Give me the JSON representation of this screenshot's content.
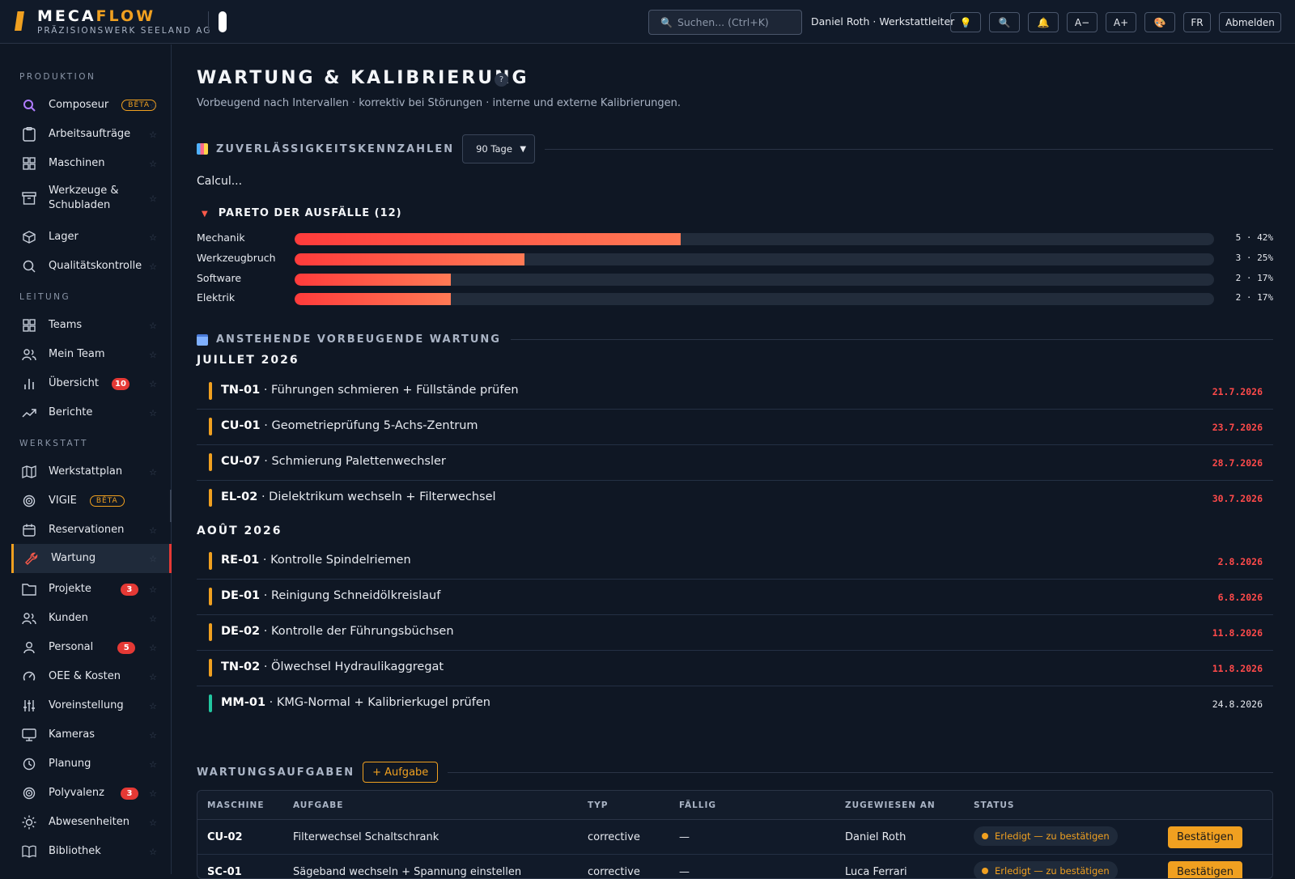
{
  "header": {
    "brand_a": "MECA",
    "brand_b": "FLOW",
    "brand_sub": "PRÄZISIONSWERK SEELAND AG",
    "search_placeholder": "Suchen...  (Ctrl+K)",
    "user": "Daniel Roth · Werkstattleiter",
    "btn_font_smaller": "A−",
    "btn_font_larger": "A+",
    "btn_lang": "FR",
    "btn_logout": "Abmelden"
  },
  "sidebar": {
    "sections": [
      "PRODUKTION",
      "LEITUNG",
      "WERKSTATT"
    ],
    "items": [
      {
        "label": "Composeur",
        "badge": "BÊTA"
      },
      {
        "label": "Arbeitsaufträge"
      },
      {
        "label": "Maschinen"
      },
      {
        "label": "Werkzeuge & Schubladen"
      },
      {
        "label": "Lager"
      },
      {
        "label": "Qualitätskontrolle"
      },
      {
        "label": "Teams"
      },
      {
        "label": "Mein Team"
      },
      {
        "label": "Übersicht",
        "count": "10"
      },
      {
        "label": "Berichte"
      },
      {
        "label": "Werkstattplan"
      },
      {
        "label": "VIGIE",
        "badge": "BÊTA"
      },
      {
        "label": "Reservationen"
      },
      {
        "label": "Wartung",
        "active": true
      },
      {
        "label": "Projekte",
        "count": "3"
      },
      {
        "label": "Kunden"
      },
      {
        "label": "Personal",
        "count": "5"
      },
      {
        "label": "OEE & Kosten"
      },
      {
        "label": "Voreinstellung"
      },
      {
        "label": "Kameras"
      },
      {
        "label": "Planung"
      },
      {
        "label": "Polyvalenz",
        "count": "3"
      },
      {
        "label": "Abwesenheiten"
      },
      {
        "label": "Bibliothek"
      }
    ]
  },
  "page": {
    "title": "WARTUNG & KALIBRIERUNG",
    "help": "?",
    "subtitle": "Vorbeugend nach Intervallen · korrektiv bei Störungen · interne und externe Kalibrierungen."
  },
  "reliability": {
    "heading": "ZUVERLÄSSIGKEITSKENNZAHLEN",
    "period": "90 Tage",
    "calc": "Calcul..."
  },
  "pareto": {
    "heading": "PARETO DER AUSFÄLLE (12)",
    "rows": [
      {
        "label": "Mechanik",
        "value": "5 · 42%",
        "fraction": 0.42
      },
      {
        "label": "Werkzeugbruch",
        "value": "3 · 25%",
        "fraction": 0.25
      },
      {
        "label": "Software",
        "value": "2 · 17%",
        "fraction": 0.17
      },
      {
        "label": "Elektrik",
        "value": "2 · 17%",
        "fraction": 0.17
      }
    ]
  },
  "preventive": {
    "heading": "ANSTEHENDE VORBEUGENDE WARTUNG",
    "months": [
      {
        "name": "JUILLET 2026",
        "items": [
          {
            "code": "TN-01",
            "text": " · Führungen schmieren + Füllstände prüfen",
            "date": "21.7.2026",
            "overdue": true
          },
          {
            "code": "CU-01",
            "text": " · Geometrieprüfung 5-Achs-Zentrum",
            "date": "23.7.2026",
            "overdue": true
          },
          {
            "code": "CU-07",
            "text": " · Schmierung Palettenwechsler",
            "date": "28.7.2026",
            "overdue": true
          },
          {
            "code": "EL-02",
            "text": " · Dielektrikum wechseln + Filterwechsel",
            "date": "30.7.2026",
            "overdue": true
          }
        ]
      },
      {
        "name": "AOÛT 2026",
        "items": [
          {
            "code": "RE-01",
            "text": " · Kontrolle Spindelriemen",
            "date": "2.8.2026",
            "overdue": true
          },
          {
            "code": "DE-01",
            "text": " · Reinigung Schneidölkreislauf",
            "date": "6.8.2026",
            "overdue": true
          },
          {
            "code": "DE-02",
            "text": " · Kontrolle der Führungsbüchsen",
            "date": "11.8.2026",
            "overdue": true
          },
          {
            "code": "TN-02",
            "text": " · Ölwechsel Hydraulikaggregat",
            "date": "11.8.2026",
            "overdue": true
          },
          {
            "code": "MM-01",
            "text": " · KMG-Normal + Kalibrierkugel prüfen",
            "date": "24.8.2026",
            "overdue": false
          }
        ]
      }
    ]
  },
  "tasks": {
    "heading": "WARTUNGSAUFGABEN",
    "add_label": "+ Aufgabe",
    "columns": [
      "MASCHINE",
      "AUFGABE",
      "TYP",
      "FÄLLIG",
      "ZUGEWIESEN AN",
      "STATUS"
    ],
    "rows": [
      {
        "machine": "CU-02",
        "task": "Filterwechsel Schaltschrank",
        "type": "corrective",
        "due": "—",
        "assignee": "Daniel Roth",
        "status": "Erledigt — zu bestätigen",
        "action": "Bestätigen"
      },
      {
        "machine": "SC-01",
        "task": "Sägeband wechseln + Spannung einstellen",
        "type": "corrective",
        "due": "—",
        "assignee": "Luca Ferrari",
        "status": "Erledigt — zu bestätigen",
        "action": "Bestätigen"
      }
    ]
  },
  "colors": {
    "accent": "#f0a020",
    "danger": "#e53935",
    "ok": "#22c7a0",
    "background": "#0f1724"
  }
}
